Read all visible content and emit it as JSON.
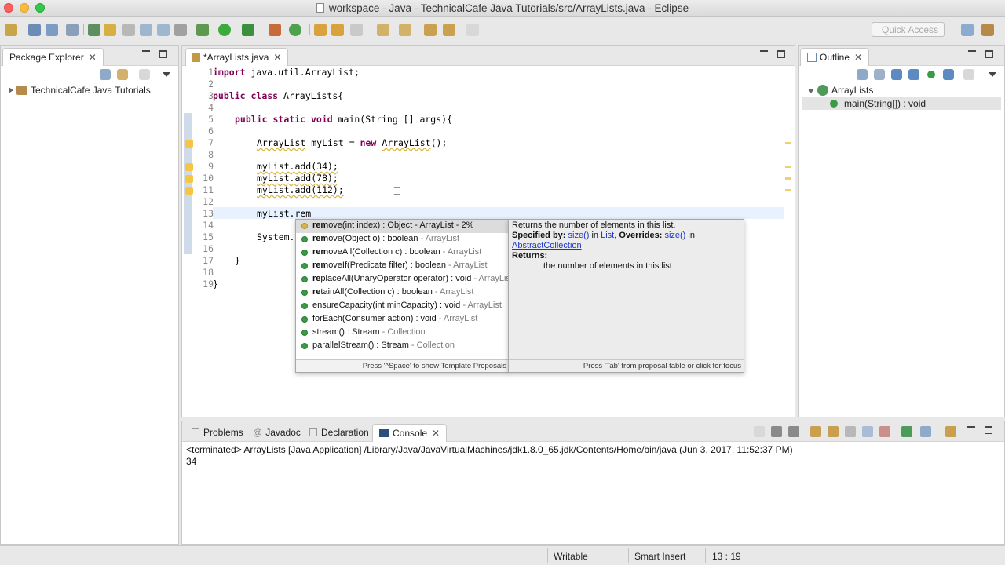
{
  "window": {
    "title": "workspace - Java - TechnicalCafe Java Tutorials/src/ArrayLists.java - Eclipse"
  },
  "toolbar": {
    "quick_access_placeholder": "Quick Access"
  },
  "package_explorer": {
    "tab_label": "Package Explorer",
    "project": "TechnicalCafe Java Tutorials"
  },
  "editor": {
    "tab_label": "*ArrayLists.java",
    "line_numbers": [
      "1",
      "2",
      "3",
      "4",
      "5",
      "6",
      "7",
      "8",
      "9",
      "10",
      "11",
      "12",
      "13",
      "14",
      "15",
      "16",
      "17",
      "18",
      "19"
    ],
    "lines": {
      "l1_kw": "import",
      "l1_rest": " java.util.ArrayList;",
      "l3_kw1": "public",
      "l3_kw2": "class",
      "l3_rest": " ArrayLists{",
      "l5_kw1": "public",
      "l5_kw2": "static",
      "l5_kw3": "void",
      "l5_rest": " main(String [] args){",
      "l7_type": "ArrayList",
      "l7_mid": " myList = ",
      "l7_kw": "new",
      "l7_ctor": "ArrayList",
      "l7_end": "();",
      "l9": "myList.add(34);",
      "l10": "myList.add(78);",
      "l11": "myList.add(112);",
      "l13": "myList.rem",
      "l15": "System.",
      "l17": "}",
      "l19": "}"
    }
  },
  "content_assist": {
    "items": [
      {
        "bold": "rem",
        "rest": "ove(int index) : Object - ArrayList - 2%",
        "dim": ""
      },
      {
        "bold": "rem",
        "rest": "ove(Object o) : boolean",
        "dim": " - ArrayList"
      },
      {
        "bold": "rem",
        "rest": "oveAll(Collection c) : boolean",
        "dim": " - ArrayList"
      },
      {
        "bold": "rem",
        "rest": "oveIf(Predicate filter) : boolean",
        "dim": " - ArrayList"
      },
      {
        "bold": "re",
        "rest": "placeAll(UnaryOperator operator) : void",
        "dim": " - ArrayList"
      },
      {
        "bold": "re",
        "rest": "tainAll(Collection c) : boolean",
        "dim": " - ArrayList"
      },
      {
        "bold": "",
        "rest": "ensureCapacity(int minCapacity) : void",
        "dim": " - ArrayList"
      },
      {
        "bold": "",
        "rest": "forEach(Consumer action) : void",
        "dim": " - ArrayList"
      },
      {
        "bold": "",
        "rest": "stream() : Stream",
        "dim": " - Collection"
      },
      {
        "bold": "",
        "rest": "parallelStream() : Stream",
        "dim": " - Collection"
      }
    ],
    "footer": "Press '^Space' to show Template Proposals"
  },
  "javadoc_popup": {
    "summary": "Returns the number of elements in this list.",
    "specified_by_label": "Specified by:",
    "specified_by_method": "size()",
    "in_word": " in ",
    "specified_by_type": "List",
    "overrides_label": "Overrides:",
    "overrides_method": "size()",
    "overrides_in": " in",
    "overrides_type": "AbstractCollection",
    "returns_label": "Returns:",
    "returns_text": "the number of elements in this list",
    "footer": "Press 'Tab' from proposal table or click for focus"
  },
  "outline": {
    "tab_label": "Outline",
    "class_name": "ArrayLists",
    "method": "main(String[]) : void"
  },
  "bottom_panel": {
    "tabs": [
      "Problems",
      "Javadoc",
      "Declaration",
      "Console"
    ],
    "console_header": "<terminated> ArrayLists [Java Application] /Library/Java/JavaVirtualMachines/jdk1.8.0_65.jdk/Contents/Home/bin/java (Jun 3, 2017, 11:52:37 PM)",
    "console_output": "34"
  },
  "status_bar": {
    "writable": "Writable",
    "insert_mode": "Smart Insert",
    "position": "13 : 19"
  }
}
